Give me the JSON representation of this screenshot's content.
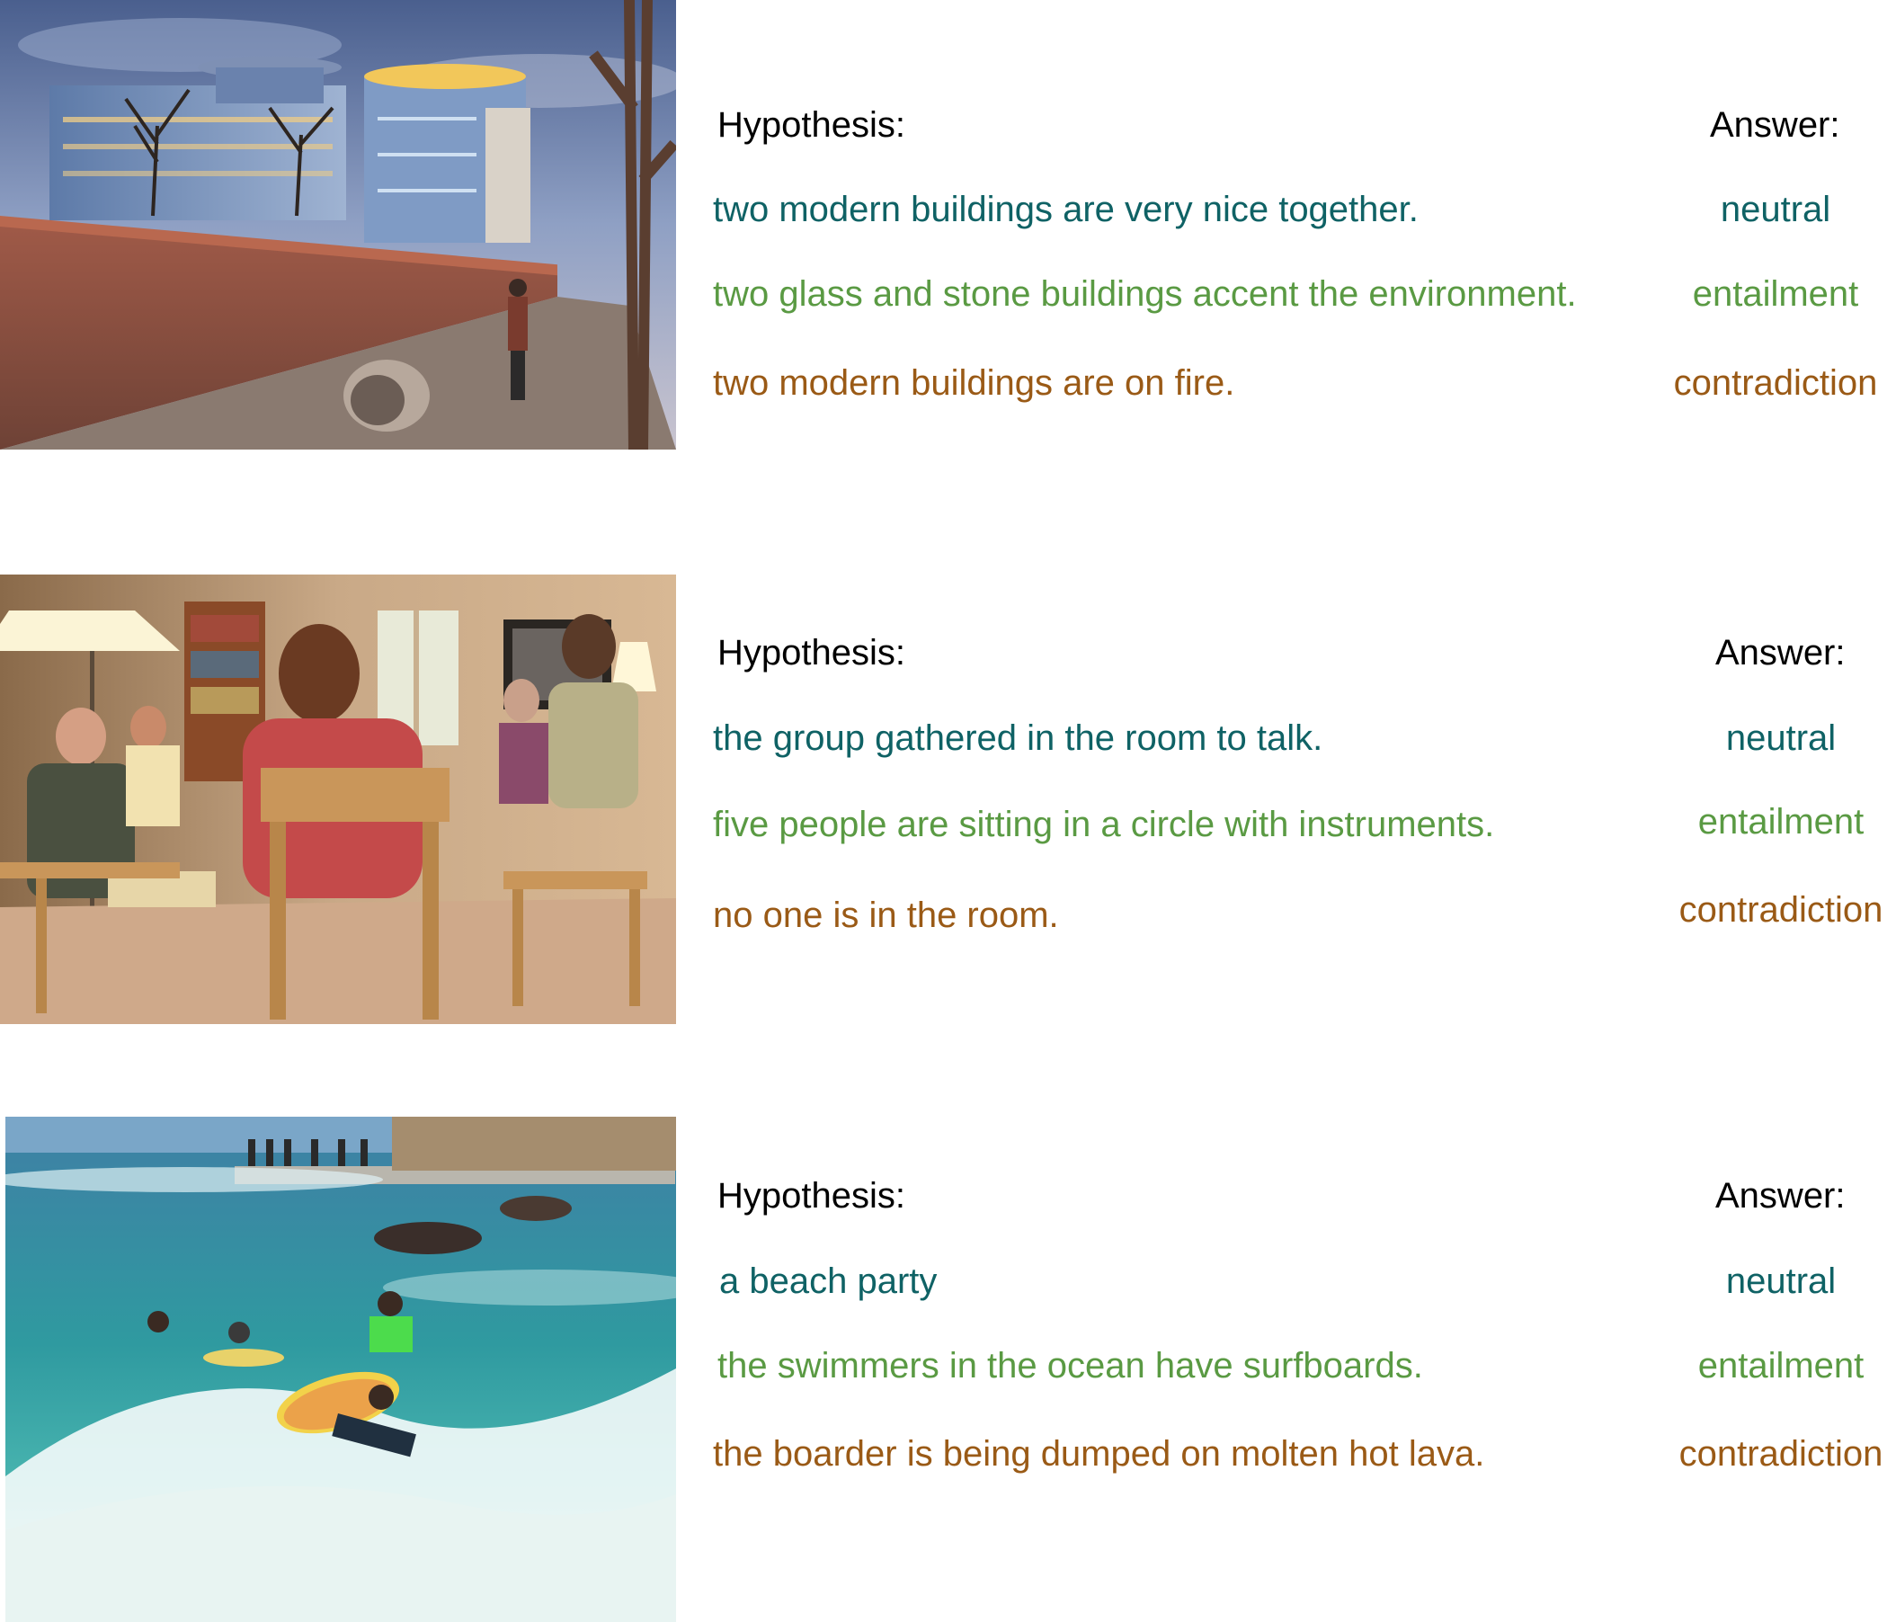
{
  "colors": {
    "neutral": "#0f6265",
    "entailment": "#5a9a43",
    "contradiction": "#9a5a16",
    "label": "#000000"
  },
  "examples": [
    {
      "image_icon": "photo-modern-buildings-street",
      "hypothesis_label": "Hypothesis:",
      "answer_label": "Answer:",
      "rows": [
        {
          "hypothesis": "two modern buildings are very nice together.",
          "answer": "neutral"
        },
        {
          "hypothesis": "two glass and stone buildings accent the environment.",
          "answer": "entailment"
        },
        {
          "hypothesis": "two modern buildings are on fire.",
          "answer": "contradiction"
        }
      ]
    },
    {
      "image_icon": "photo-musicians-living-room",
      "hypothesis_label": "Hypothesis:",
      "answer_label": "Answer:",
      "rows": [
        {
          "hypothesis": "the group gathered in the room to talk.",
          "answer": "neutral"
        },
        {
          "hypothesis": "five people are sitting in a circle with instruments.",
          "answer": "entailment"
        },
        {
          "hypothesis": "no one is in the room.",
          "answer": "contradiction"
        }
      ]
    },
    {
      "image_icon": "photo-bodyboarder-ocean-wave",
      "hypothesis_label": "Hypothesis:",
      "answer_label": "Answer:",
      "rows": [
        {
          "hypothesis": "a beach party",
          "answer": "neutral"
        },
        {
          "hypothesis": "the swimmers in the ocean have surfboards.",
          "answer": "entailment"
        },
        {
          "hypothesis": "the boarder is being dumped on molten hot lava.",
          "answer": "contradiction"
        }
      ]
    }
  ]
}
